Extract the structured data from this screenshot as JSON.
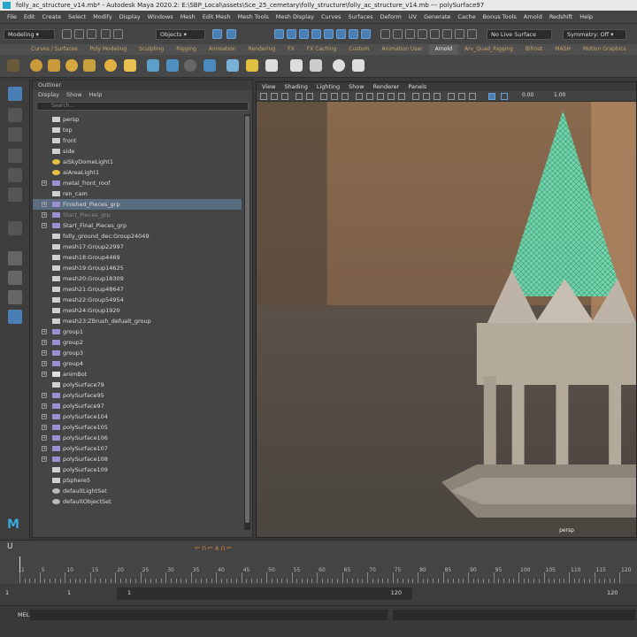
{
  "window": {
    "title": "folly_ac_structure_v14.mb* - Autodesk Maya 2020.2: E:\\SBP_Local\\assets\\Sce_25_cemetary\\folly_structure\\folly_ac_structure_v14.mb --- polySurface97"
  },
  "menu": [
    "File",
    "Edit",
    "Create",
    "Select",
    "Modify",
    "Display",
    "Windows",
    "Mesh",
    "Edit Mesh",
    "Mesh Tools",
    "Mesh Display",
    "Curves",
    "Surfaces",
    "Deform",
    "UV",
    "Generate",
    "Cache",
    "Bonus Tools",
    "Arnold",
    "Redshift",
    "Help"
  ],
  "status_line": {
    "menuset": "Modeling",
    "selection_mode": "Objects",
    "live_surface": "No Live Surface",
    "symmetry": "Symmetry: Off"
  },
  "shelf_tabs": [
    "Curves / Surfaces",
    "Poly Modeling",
    "Sculpting",
    "Rigging",
    "Animation",
    "Rendering",
    "FX",
    "FX Caching",
    "Custom",
    "Animation User",
    "Arnold",
    "Arv_Quad_Rigging",
    "Bifrost",
    "MASH",
    "Motion Graphics"
  ],
  "shelf_active": "Arnold",
  "outliner": {
    "title": "Outliner",
    "menu": [
      "Display",
      "Show",
      "Help"
    ],
    "search_placeholder": "Search...",
    "items": [
      {
        "label": "persp",
        "icon": "camera",
        "indent": 1
      },
      {
        "label": "top",
        "icon": "camera",
        "indent": 1
      },
      {
        "label": "front",
        "icon": "camera",
        "indent": 1
      },
      {
        "label": "side",
        "icon": "camera",
        "indent": 1
      },
      {
        "label": "aiSkyDomeLight1",
        "icon": "light",
        "indent": 1
      },
      {
        "label": "aiAreaLight1",
        "icon": "light",
        "indent": 1
      },
      {
        "label": "metal_front_roof",
        "icon": "group",
        "indent": 1,
        "expand": true
      },
      {
        "label": "ren_cam",
        "icon": "camera",
        "indent": 1
      },
      {
        "label": "Finished_Pieces_grp",
        "icon": "group",
        "indent": 1,
        "expand": true,
        "selected": true
      },
      {
        "label": "Start_Pieces_grp",
        "icon": "group",
        "indent": 1,
        "expand": true,
        "dim": true
      },
      {
        "label": "Start_Final_Pieces_grp",
        "icon": "group",
        "indent": 1,
        "expand": true
      },
      {
        "label": "folly_ground_dec:Group24049",
        "icon": "mesh",
        "indent": 1
      },
      {
        "label": "mesh17:Group22997",
        "icon": "mesh",
        "indent": 1
      },
      {
        "label": "mesh18:Group4469",
        "icon": "mesh",
        "indent": 1
      },
      {
        "label": "mesh19:Group14625",
        "icon": "mesh",
        "indent": 1
      },
      {
        "label": "mesh20:Group18309",
        "icon": "mesh",
        "indent": 1
      },
      {
        "label": "mesh21:Group48647",
        "icon": "mesh",
        "indent": 1
      },
      {
        "label": "mesh22:Group54954",
        "icon": "mesh",
        "indent": 1
      },
      {
        "label": "mesh24:Group1920",
        "icon": "mesh",
        "indent": 1
      },
      {
        "label": "mesh23:ZBrush_defualt_group",
        "icon": "mesh",
        "indent": 1
      },
      {
        "label": "group1",
        "icon": "group",
        "indent": 1,
        "expand": true
      },
      {
        "label": "group2",
        "icon": "group",
        "indent": 1,
        "expand": true
      },
      {
        "label": "group3",
        "icon": "group",
        "indent": 1,
        "expand": true
      },
      {
        "label": "group4",
        "icon": "group",
        "indent": 1,
        "expand": true
      },
      {
        "label": "animBot",
        "icon": "magnet",
        "indent": 1,
        "expand": true
      },
      {
        "label": "polySurface79",
        "icon": "mesh",
        "indent": 1
      },
      {
        "label": "polySurface95",
        "icon": "group",
        "indent": 1,
        "expand": true
      },
      {
        "label": "polySurface97",
        "icon": "group",
        "indent": 1,
        "expand": true
      },
      {
        "label": "polySurface104",
        "icon": "group",
        "indent": 1,
        "expand": true
      },
      {
        "label": "polySurface105",
        "icon": "group",
        "indent": 1,
        "expand": true
      },
      {
        "label": "polySurface106",
        "icon": "group",
        "indent": 1,
        "expand": true
      },
      {
        "label": "polySurface107",
        "icon": "group",
        "indent": 1,
        "expand": true
      },
      {
        "label": "polySurface108",
        "icon": "group",
        "indent": 1,
        "expand": true
      },
      {
        "label": "polySurface109",
        "icon": "mesh",
        "indent": 1
      },
      {
        "label": "pSphere5",
        "icon": "mesh",
        "indent": 1
      },
      {
        "label": "defaultLightSet",
        "icon": "set",
        "indent": 1
      },
      {
        "label": "defaultObjectSet",
        "icon": "set",
        "indent": 1
      }
    ]
  },
  "viewport": {
    "menu": [
      "View",
      "Shading",
      "Lighting",
      "Show",
      "Renderer",
      "Panels"
    ],
    "exposure": "0.00",
    "gamma": "1.00",
    "camera_label": "persp"
  },
  "timeline": {
    "frames": [
      "1",
      "5",
      "10",
      "15",
      "20",
      "25",
      "30",
      "35",
      "40",
      "45",
      "50",
      "55",
      "60",
      "65",
      "70",
      "75",
      "80",
      "85",
      "90",
      "95",
      "100",
      "105",
      "110",
      "115",
      "120"
    ],
    "current_frame": "1",
    "range_start": "1",
    "range_inner_start": "1",
    "range_inner_end": "120",
    "range_end": "120",
    "playback_start": "1",
    "playback_end": "120"
  },
  "command_line": {
    "label": "MEL"
  },
  "colors": {
    "accent_teal": "#6de0b5",
    "selection": "#5a6c80",
    "tab_text": "#c9a567"
  }
}
